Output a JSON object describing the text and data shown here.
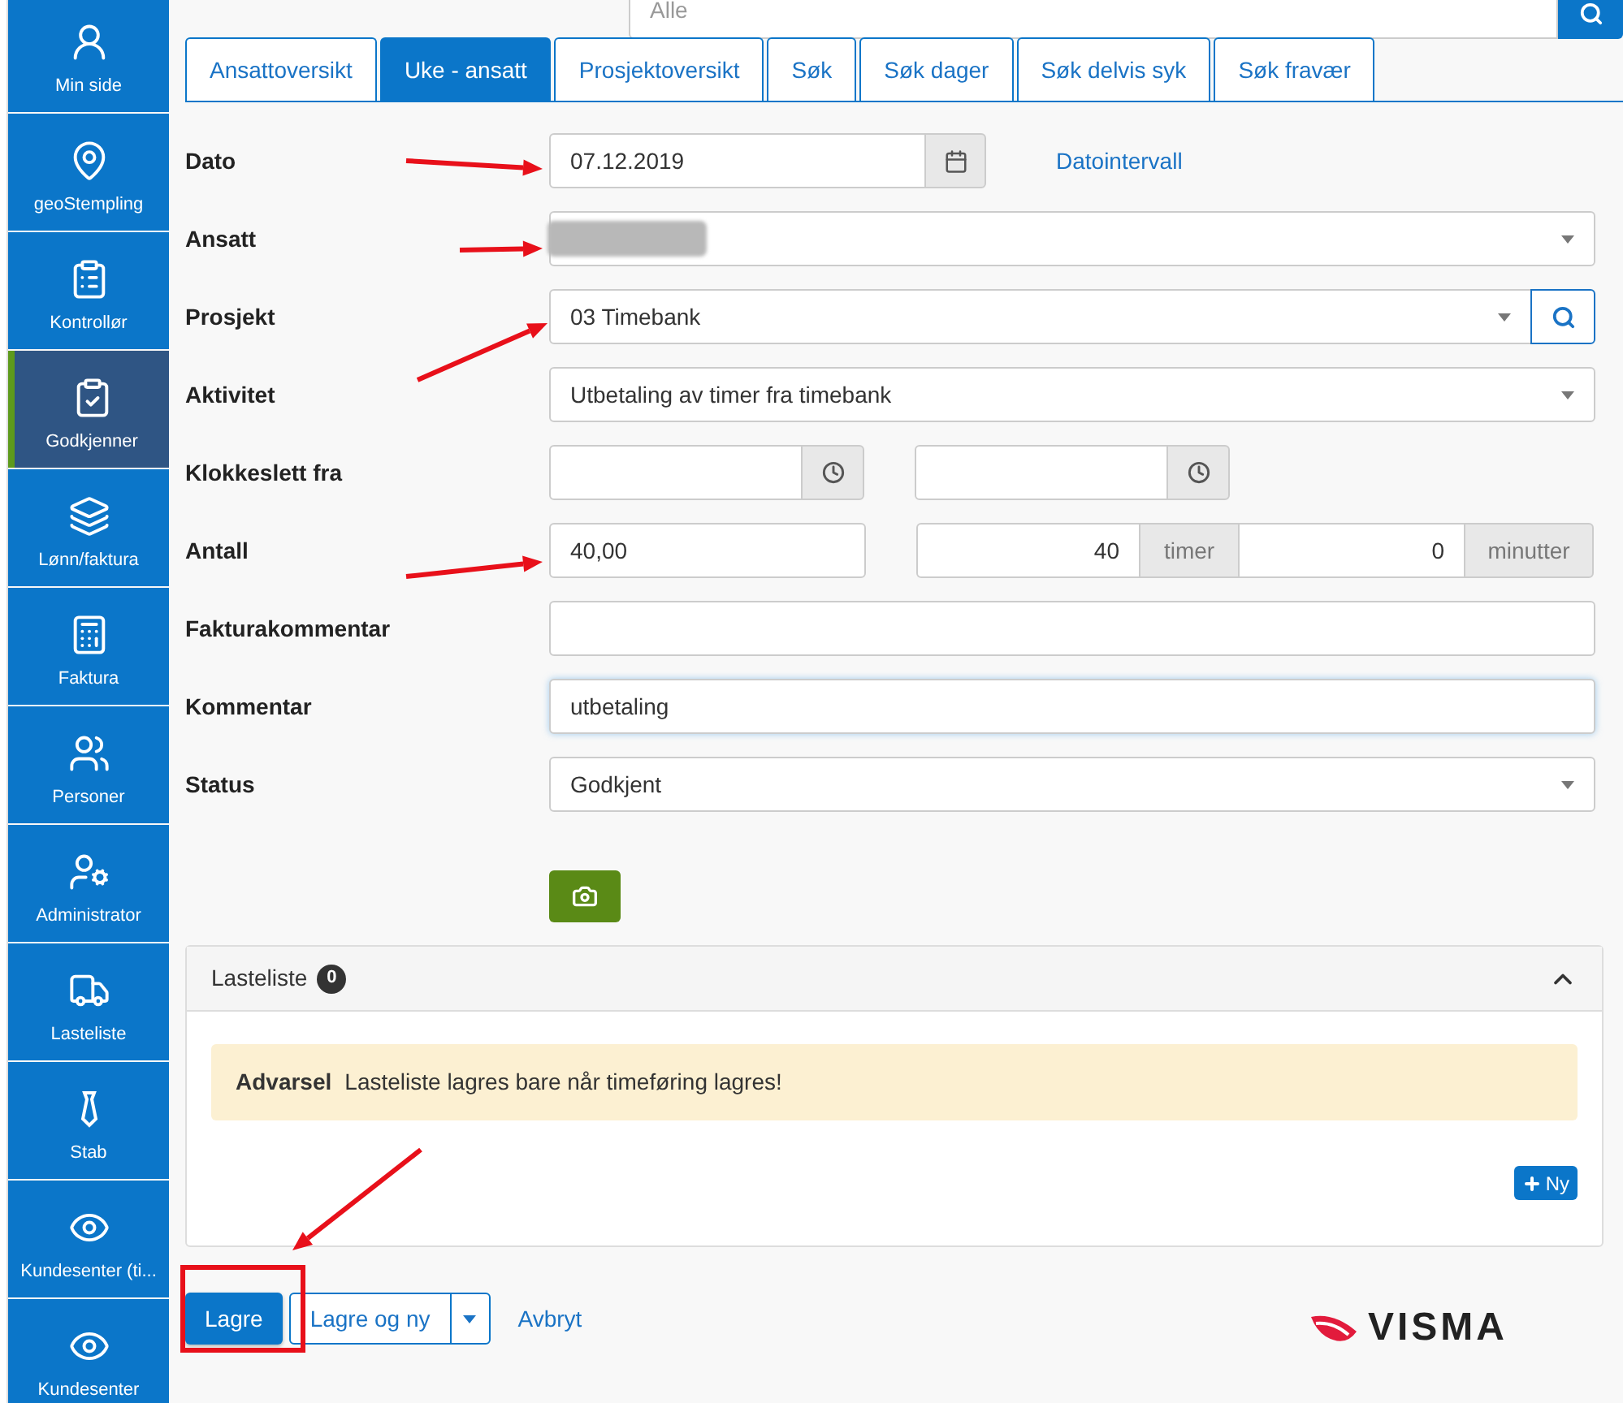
{
  "sidebar": {
    "items": [
      {
        "label": "Min side",
        "selected": false
      },
      {
        "label": "geoStempling",
        "selected": false
      },
      {
        "label": "Kontrollør",
        "selected": false
      },
      {
        "label": "Godkjenner",
        "selected": true
      },
      {
        "label": "Lønn/faktura",
        "selected": false
      },
      {
        "label": "Faktura",
        "selected": false
      },
      {
        "label": "Personer",
        "selected": false
      },
      {
        "label": "Administrator",
        "selected": false
      },
      {
        "label": "Lasteliste",
        "selected": false
      },
      {
        "label": "Stab",
        "selected": false
      },
      {
        "label": "Kundesenter (ti...",
        "selected": false
      },
      {
        "label": "Kundesenter",
        "selected": false
      }
    ]
  },
  "top_search": {
    "placeholder": "Alle"
  },
  "tabs": [
    {
      "label": "Ansattoversikt",
      "selected": false
    },
    {
      "label": "Uke - ansatt",
      "selected": true
    },
    {
      "label": "Prosjektoversikt",
      "selected": false
    },
    {
      "label": "Søk",
      "selected": false
    },
    {
      "label": "Søk dager",
      "selected": false
    },
    {
      "label": "Søk delvis syk",
      "selected": false
    },
    {
      "label": "Søk fravær",
      "selected": false
    }
  ],
  "form": {
    "rows": [
      {
        "kind": "date",
        "label": "Dato",
        "value": "07.12.2019",
        "link": "Datointervall"
      },
      {
        "kind": "select",
        "label": "Ansatt",
        "value": ""
      },
      {
        "kind": "select_search",
        "label": "Prosjekt",
        "value": "03 Timebank"
      },
      {
        "kind": "select",
        "label": "Aktivitet",
        "value": "Utbetaling av timer fra timebank"
      },
      {
        "kind": "time_range",
        "label": "Klokkeslett fra"
      },
      {
        "kind": "quantity",
        "label": "Antall",
        "value": "40,00",
        "hours": "40",
        "hours_unit": "timer",
        "minutes": "0",
        "minutes_unit": "minutter"
      },
      {
        "kind": "text",
        "label": "Fakturakommentar",
        "value": "",
        "focused": false
      },
      {
        "kind": "text",
        "label": "Kommentar",
        "value": "utbetaling",
        "focused": true
      },
      {
        "kind": "select",
        "label": "Status",
        "value": "Godkjent"
      }
    ]
  },
  "lasteliste": {
    "title": "Lasteliste",
    "count": "0",
    "expanded": true,
    "warning_title": "Advarsel",
    "warning_text": "Lasteliste lagres bare når timeføring lagres!",
    "new_button": "Ny"
  },
  "actions": {
    "save": "Lagre",
    "save_new": "Lagre og ny",
    "cancel": "Avbryt"
  },
  "logo": {
    "text": "VISMA"
  }
}
